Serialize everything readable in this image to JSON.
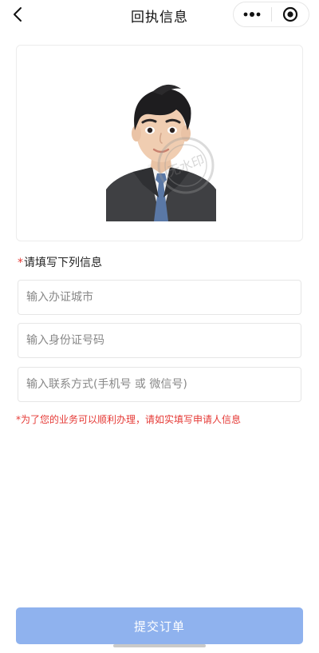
{
  "nav": {
    "title": "回执信息",
    "back_icon": "chevron-left-icon",
    "more_icon": "more-dots-icon",
    "close_icon": "record-target-icon"
  },
  "photo": {
    "watermark_text": "无水印"
  },
  "form": {
    "section_required_mark": "*",
    "section_title": "请填写下列信息",
    "city_input": {
      "value": "",
      "placeholder": "输入办证城市"
    },
    "id_input": {
      "value": "",
      "placeholder": "输入身份证号码"
    },
    "contact_input": {
      "value": "",
      "placeholder": "输入联系方式(手机号 或 微信号)"
    },
    "hint": "*为了您的业务可以顺利办理，请如实填写申请人信息"
  },
  "submit": {
    "label": "提交订单",
    "color": "#8fb2ee"
  },
  "colors": {
    "required": "#e53935",
    "hint": "#e53935",
    "button": "#8fb2ee"
  }
}
